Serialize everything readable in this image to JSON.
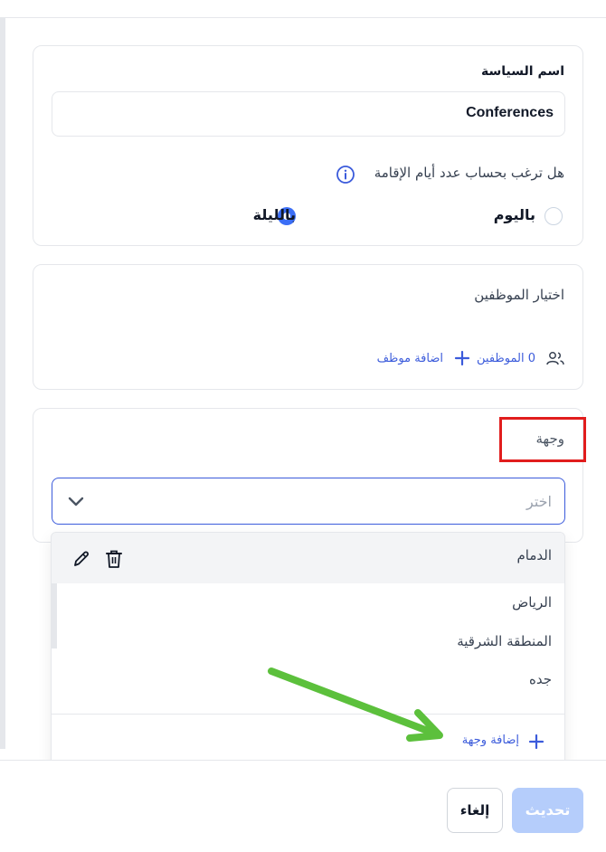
{
  "policy": {
    "name_label": "اسم السياسة",
    "name_value": "Conferences"
  },
  "stay_calc": {
    "question": "هل ترغب بحساب عدد أيام الإقامة",
    "options": [
      {
        "label": "باليوم",
        "selected": false
      },
      {
        "label": "بالليلة",
        "selected": true
      }
    ]
  },
  "employees": {
    "title": "اختيار الموظفين",
    "count_text": "0 الموظفين",
    "add_label": "اضافة موظف"
  },
  "destination": {
    "label": "وجهة",
    "placeholder": "اختر",
    "options": [
      "الدمام",
      "الرياض",
      "المنطقة الشرقية",
      "جده"
    ],
    "add_label": "إضافة وجهة"
  },
  "footer": {
    "update_label": "تحديث",
    "cancel_label": "إلغاء"
  },
  "colors": {
    "accent": "#3b5bdb",
    "radio_active": "#3b6ef6",
    "update_button_disabled": "#b5cdfb",
    "annotation_box": "#e11d1d",
    "annotation_arrow": "#5cc03c"
  },
  "icons": [
    "info-icon",
    "users-icon",
    "plus-icon",
    "chevron-down-icon",
    "edit-icon",
    "trash-icon"
  ]
}
